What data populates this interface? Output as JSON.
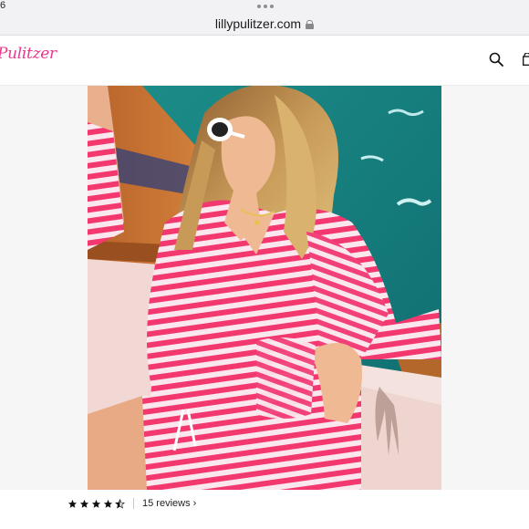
{
  "status_bar": {
    "left_text": "6"
  },
  "browser": {
    "url": "lillypulitzer.com"
  },
  "header": {
    "logo_text": "Pulitzer",
    "search_icon": "search-icon",
    "bag_icon": "shopping-bag-icon"
  },
  "product": {
    "image_alt": "Model wearing pink and white striped hoodie pullover and matching shorts on a boat",
    "rating": 4.5,
    "rating_max": 5,
    "reviews_label": "15 reviews ›"
  },
  "colors": {
    "brand_pink": "#e8388b",
    "stripe_pink": "#f2386f"
  }
}
